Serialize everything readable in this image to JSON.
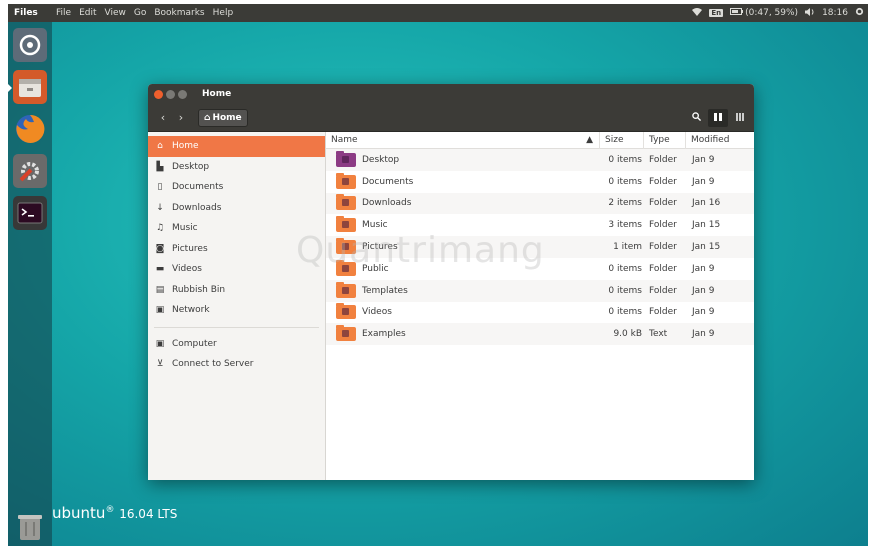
{
  "topbar": {
    "app_name": "Files",
    "menus": [
      "File",
      "Edit",
      "View",
      "Go",
      "Bookmarks",
      "Help"
    ],
    "keyboard": "En",
    "battery": "(0:47, 59%)",
    "clock": "18:16"
  },
  "launcher": {
    "items": [
      "dash-icon",
      "files-icon",
      "firefox-icon",
      "settings-icon",
      "terminal-icon",
      "trash-icon"
    ]
  },
  "wallpaper": {
    "text": "ubuntu",
    "version": "16.04 LTS"
  },
  "window": {
    "title": "Home",
    "path": "Home",
    "sidebar": [
      {
        "label": "Home",
        "icon": "home-icon",
        "selected": true
      },
      {
        "label": "Desktop",
        "icon": "desktop-icon"
      },
      {
        "label": "Documents",
        "icon": "documents-icon"
      },
      {
        "label": "Downloads",
        "icon": "downloads-icon"
      },
      {
        "label": "Music",
        "icon": "music-icon"
      },
      {
        "label": "Pictures",
        "icon": "pictures-icon"
      },
      {
        "label": "Videos",
        "icon": "videos-icon"
      },
      {
        "label": "Rubbish Bin",
        "icon": "trash-icon"
      },
      {
        "label": "Network",
        "icon": "network-icon"
      },
      {
        "label": "Computer",
        "icon": "computer-icon"
      },
      {
        "label": "Connect to Server",
        "icon": "server-icon"
      }
    ],
    "columns": {
      "name": "Name",
      "size": "Size",
      "type": "Type",
      "modified": "Modified"
    },
    "files": [
      {
        "name": "Desktop",
        "size": "0 items",
        "type": "Folder",
        "modified": "Jan 9",
        "color": "#8c3b84"
      },
      {
        "name": "Documents",
        "size": "0 items",
        "type": "Folder",
        "modified": "Jan 9",
        "color": "#f1813f"
      },
      {
        "name": "Downloads",
        "size": "2 items",
        "type": "Folder",
        "modified": "Jan 16",
        "color": "#f1813f"
      },
      {
        "name": "Music",
        "size": "3 items",
        "type": "Folder",
        "modified": "Jan 15",
        "color": "#f1813f"
      },
      {
        "name": "Pictures",
        "size": "1 item",
        "type": "Folder",
        "modified": "Jan 15",
        "color": "#f1813f"
      },
      {
        "name": "Public",
        "size": "0 items",
        "type": "Folder",
        "modified": "Jan 9",
        "color": "#f1813f"
      },
      {
        "name": "Templates",
        "size": "0 items",
        "type": "Folder",
        "modified": "Jan 9",
        "color": "#f1813f"
      },
      {
        "name": "Videos",
        "size": "0 items",
        "type": "Folder",
        "modified": "Jan 9",
        "color": "#f1813f"
      },
      {
        "name": "Examples",
        "size": "9.0 kB",
        "type": "Text",
        "modified": "Jan 9",
        "color": "#f1813f"
      }
    ]
  },
  "watermark": "Quantrimang"
}
